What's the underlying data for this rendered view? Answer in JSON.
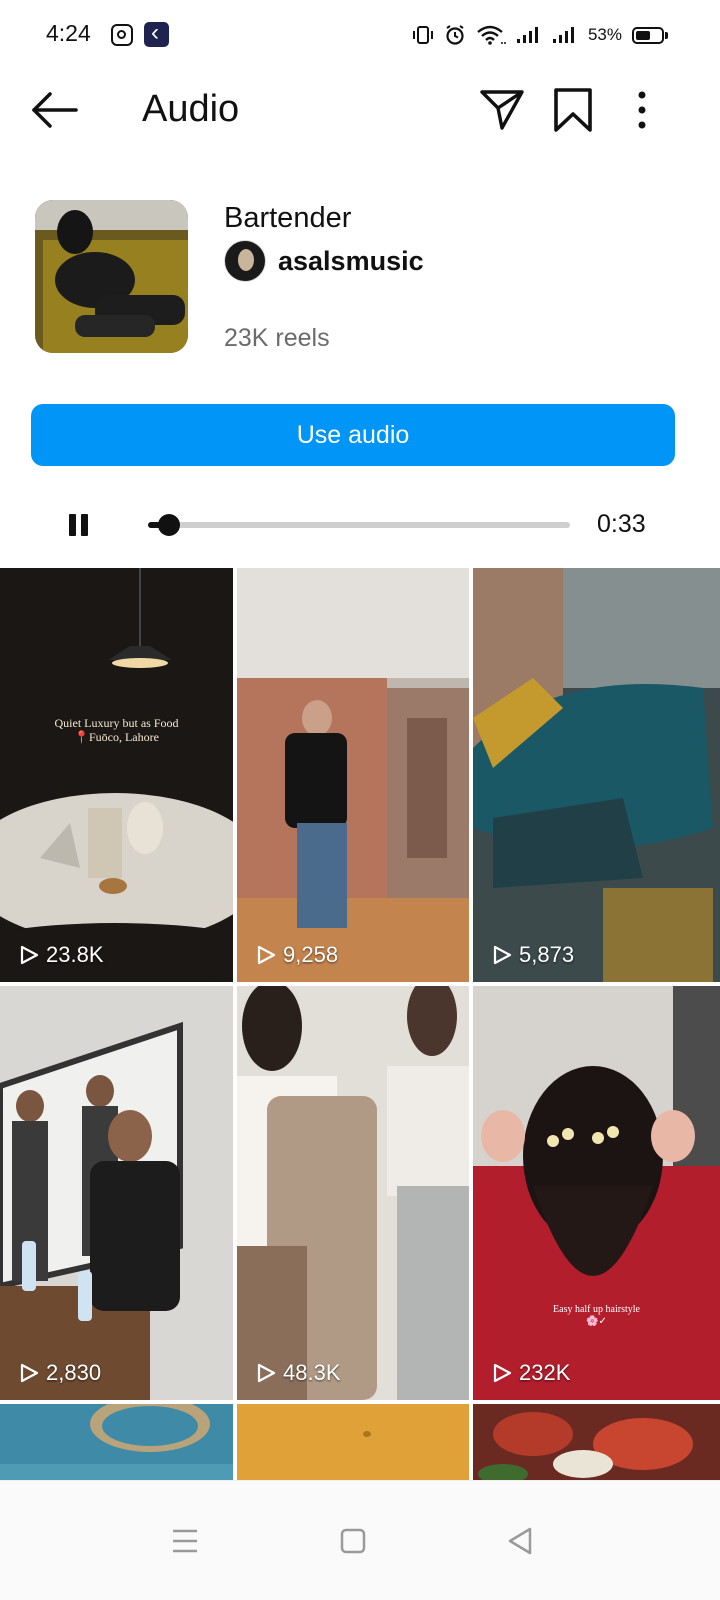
{
  "status_bar": {
    "time": "4:24",
    "battery_percent": "53%",
    "icons": [
      "instagram-icon",
      "app-icon",
      "vibrate-icon",
      "alarm-icon",
      "wifi-icon",
      "signal-icon",
      "signal-icon",
      "battery-icon"
    ]
  },
  "header": {
    "title": "Audio",
    "back_icon": "back-arrow-icon",
    "share_icon": "send-icon",
    "save_icon": "bookmark-icon",
    "more_icon": "more-vertical-icon"
  },
  "audio": {
    "title": "Bartender",
    "artist": "asalsmusic",
    "reels_count": "23K reels",
    "use_audio_label": "Use audio",
    "remaining_time": "0:33",
    "progress": 0.05
  },
  "reels": [
    {
      "views": "23.8K",
      "caption_line1": "Quiet Luxury but as Food",
      "caption_line2": "📍Fuōco, Lahore"
    },
    {
      "views": "9,258"
    },
    {
      "views": "5,873"
    },
    {
      "views": "2,830"
    },
    {
      "views": "48.3K"
    },
    {
      "views": "232K",
      "caption_line1": "Easy half up hairstyle",
      "caption_line2": "🌸✓"
    }
  ],
  "colors": {
    "accent": "#0095f6"
  },
  "nav": {
    "icons": [
      "menu-icon",
      "home-square-icon",
      "back-triangle-icon"
    ]
  }
}
